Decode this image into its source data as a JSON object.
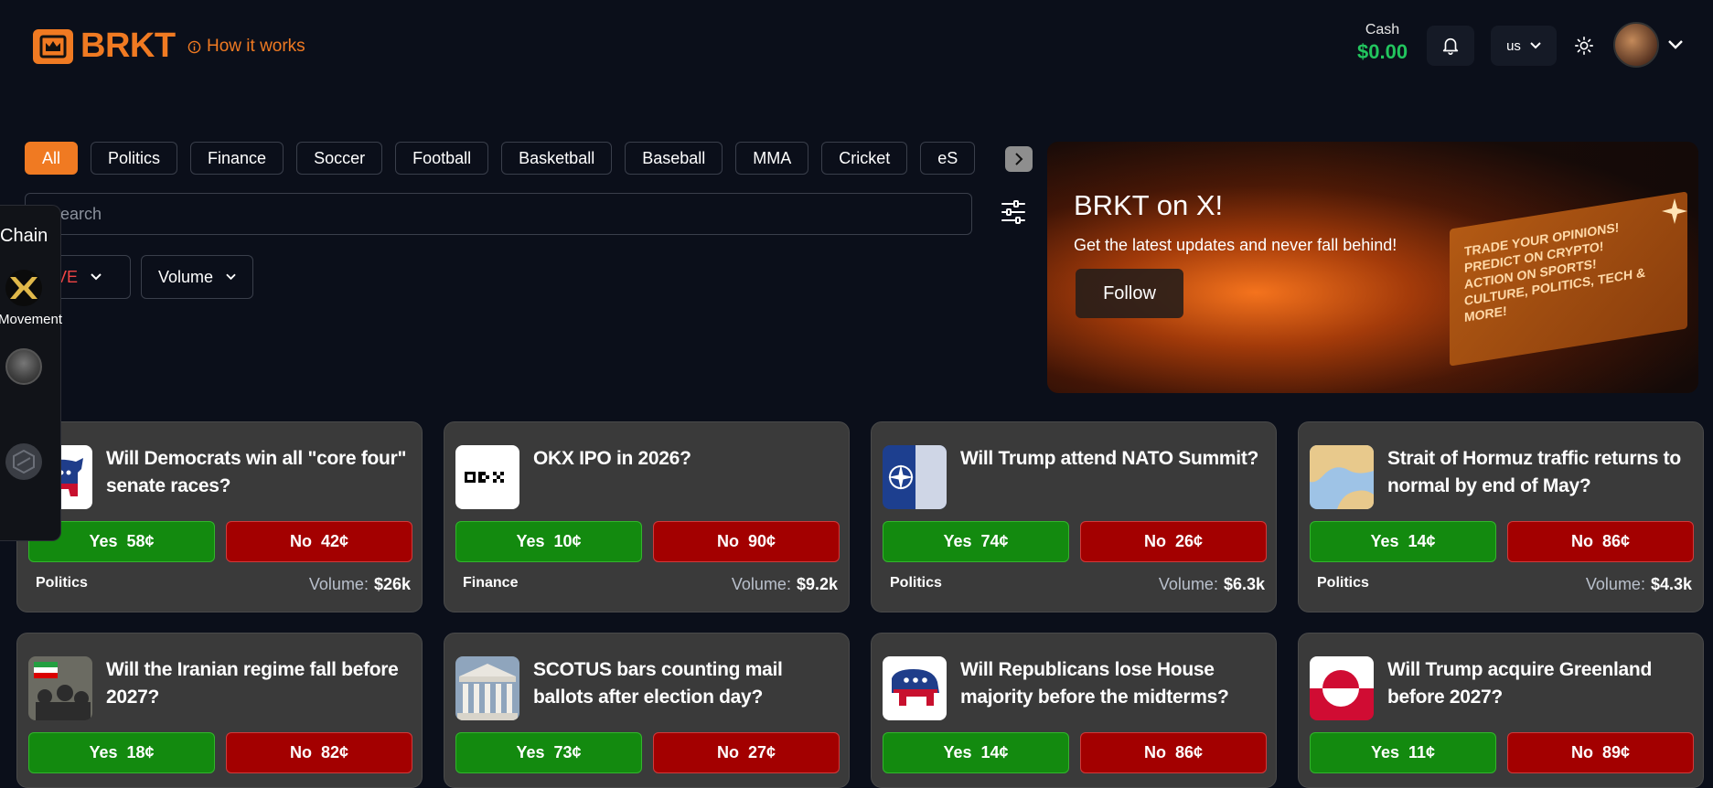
{
  "header": {
    "logo_text": "BRKT",
    "how_it_works": "How it works",
    "cash_label": "Cash",
    "cash_value": "$0.00",
    "region": "us"
  },
  "filters": {
    "pills": [
      "All",
      "Politics",
      "Finance",
      "Soccer",
      "Football",
      "Basketball",
      "Baseball",
      "MMA",
      "Cricket",
      "eS"
    ],
    "active": "All",
    "search_placeholder": "Search",
    "status_dropdown": "LIVE",
    "sort_dropdown": "Volume"
  },
  "chain_panel": {
    "title": "Chain",
    "label": "Movement"
  },
  "banner": {
    "title": "BRKT on X!",
    "subtitle": "Get the latest updates and never fall behind!",
    "follow": "Follow",
    "billboard_lines": [
      "TRADE YOUR OPINIONS!",
      "PREDICT ON CRYPTO!",
      "ACTION ON SPORTS!",
      "CULTURE, POLITICS, TECH & MORE!"
    ]
  },
  "markets": [
    {
      "title": "Will Democrats win all \"core four\" senate races?",
      "yes": "58¢",
      "no": "42¢",
      "category": "Politics",
      "volume": "$26k",
      "image": "democrat-donkey"
    },
    {
      "title": "OKX IPO in 2026?",
      "yes": "10¢",
      "no": "90¢",
      "category": "Finance",
      "volume": "$9.2k",
      "image": "okx-logo"
    },
    {
      "title": "Will Trump attend NATO Summit?",
      "yes": "74¢",
      "no": "26¢",
      "category": "Politics",
      "volume": "$6.3k",
      "image": "nato-logo"
    },
    {
      "title": "Strait of Hormuz traffic returns to normal by end of May?",
      "yes": "14¢",
      "no": "86¢",
      "category": "Politics",
      "volume": "$4.3k",
      "image": "hormuz-map"
    },
    {
      "title": "Will the Iranian regime fall before 2027?",
      "yes": "18¢",
      "no": "82¢",
      "category": "",
      "volume": "",
      "image": "iran-protest"
    },
    {
      "title": "SCOTUS bars counting mail ballots after election day?",
      "yes": "73¢",
      "no": "27¢",
      "category": "",
      "volume": "",
      "image": "supreme-court"
    },
    {
      "title": "Will Republicans lose House majority before the midterms?",
      "yes": "14¢",
      "no": "86¢",
      "category": "",
      "volume": "",
      "image": "republican-elephant"
    },
    {
      "title": "Will Trump acquire Greenland before 2027?",
      "yes": "11¢",
      "no": "89¢",
      "category": "",
      "volume": "",
      "image": "greenland-flag"
    }
  ],
  "labels": {
    "yes": "Yes",
    "no": "No",
    "volume": "Volume:"
  },
  "colors": {
    "brand": "#f07a22",
    "yes": "#138a0f",
    "no": "#a30000",
    "cash": "#22c55e"
  }
}
